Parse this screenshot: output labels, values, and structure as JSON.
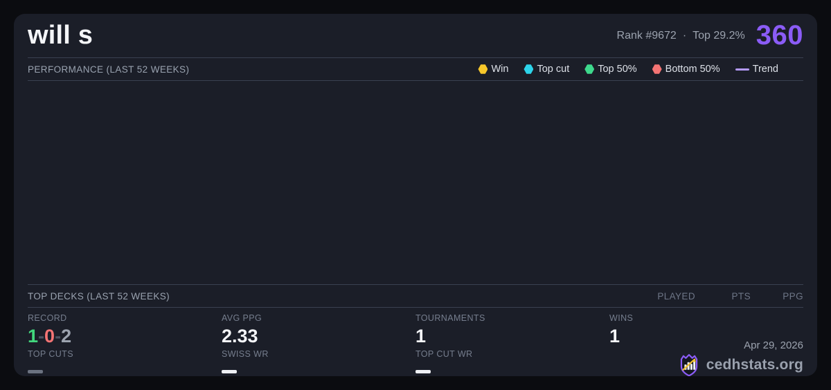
{
  "colors": {
    "accent": "#8b5cf6",
    "win": "#f6c72a",
    "topcut": "#2dd4ea",
    "top50": "#3ed98c",
    "bottom50": "#f47474",
    "trend": "#b49afc",
    "green": "#42d77d",
    "red": "#f47474"
  },
  "header": {
    "player_name": "will s",
    "rank": "Rank #9672",
    "separator": "·",
    "top_percent": "Top 29.2%",
    "points": "360"
  },
  "performance": {
    "title": "PERFORMANCE (LAST 52 WEEKS)",
    "legend": [
      {
        "label": "Win"
      },
      {
        "label": "Top cut"
      },
      {
        "label": "Top 50%"
      },
      {
        "label": "Bottom 50%"
      },
      {
        "label": "Trend"
      }
    ]
  },
  "top_decks": {
    "title": "TOP DECKS (LAST 52 WEEKS)",
    "columns": [
      "PLAYED",
      "PTS",
      "PPG"
    ]
  },
  "stats": {
    "record": {
      "label": "RECORD",
      "wins": "1",
      "sep": "-",
      "losses": "0",
      "draws": "2"
    },
    "avg_ppg": {
      "label": "AVG PPG",
      "value": "2.33"
    },
    "tournaments": {
      "label": "TOURNAMENTS",
      "value": "1"
    },
    "wins": {
      "label": "WINS",
      "value": "1"
    },
    "top_cuts": {
      "label": "TOP CUTS",
      "value": "—"
    },
    "swiss_wr": {
      "label": "SWISS WR",
      "value": "—"
    },
    "top_cut_wr": {
      "label": "TOP CUT WR",
      "value": "—"
    }
  },
  "footer": {
    "date": "Apr 29, 2026",
    "brand": "cedhstats.org"
  }
}
